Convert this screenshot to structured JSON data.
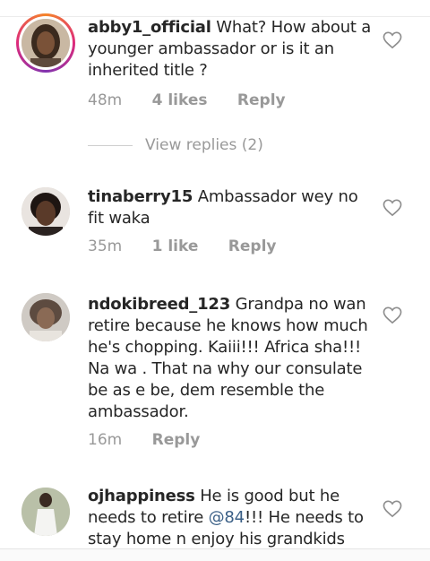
{
  "comments": [
    {
      "username": "abby1_official",
      "text": "What? How about a younger ambassador or is it an inherited title ?",
      "time": "48m",
      "likes": "4 likes",
      "reply": "Reply",
      "has_story_ring": true,
      "view_replies": "View replies (2)"
    },
    {
      "username": "tinaberry15",
      "text": "Ambassador wey no fit waka",
      "time": "35m",
      "likes": "1 like",
      "reply": "Reply"
    },
    {
      "username": "ndokibreed_123",
      "text": "Grandpa no wan retire because he knows how much he's chopping. Kaiii!!! Africa sha!!! Na wa . That na why our consulate be as e be, dem resemble the ambassador.",
      "time": "16m",
      "reply": "Reply"
    },
    {
      "username": "ojhappiness",
      "text_before": "He is good but he needs to retire ",
      "mention": "@84",
      "text_after": "!!! He needs to stay home n enjoy his grandkids"
    }
  ],
  "icons": {
    "like": "heart-outline-icon"
  },
  "colors": {
    "text": "#262626",
    "meta": "#999999",
    "mention": "#3a5f86",
    "story_ring_start": "#f58529",
    "story_ring_end": "#8134af"
  }
}
